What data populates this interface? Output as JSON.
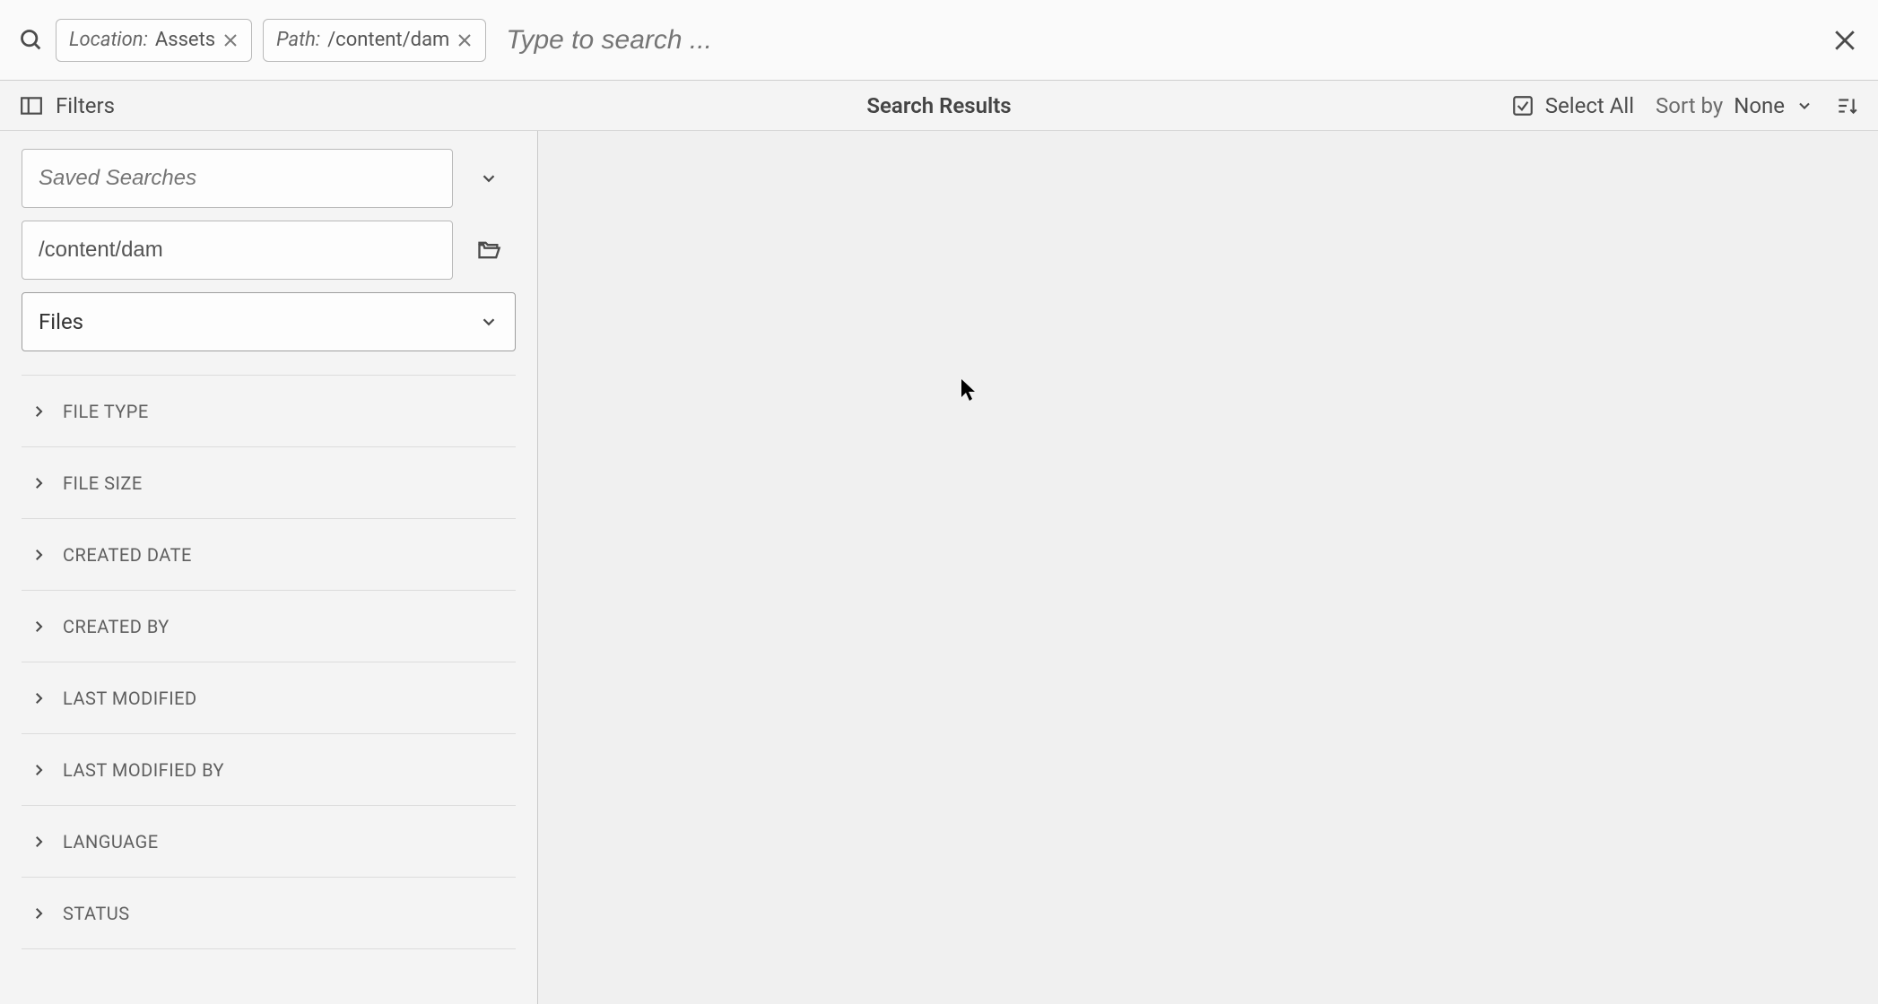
{
  "topbar": {
    "search_placeholder": "Type to search ...",
    "chips": [
      {
        "key": "Location:",
        "value": " Assets"
      },
      {
        "key": "Path:",
        "value": "/content/dam"
      }
    ]
  },
  "toolbar": {
    "filters_label": "Filters",
    "results_title": "Search Results",
    "select_all_label": "Select All",
    "sort_by_label": "Sort by",
    "sort_value": "None"
  },
  "sidebar": {
    "saved_searches_placeholder": "Saved Searches",
    "path_value": "/content/dam",
    "type_select_value": "Files",
    "accordions": [
      "FILE TYPE",
      "FILE SIZE",
      "CREATED DATE",
      "CREATED BY",
      "LAST MODIFIED",
      "LAST MODIFIED BY",
      "LANGUAGE",
      "STATUS"
    ]
  }
}
